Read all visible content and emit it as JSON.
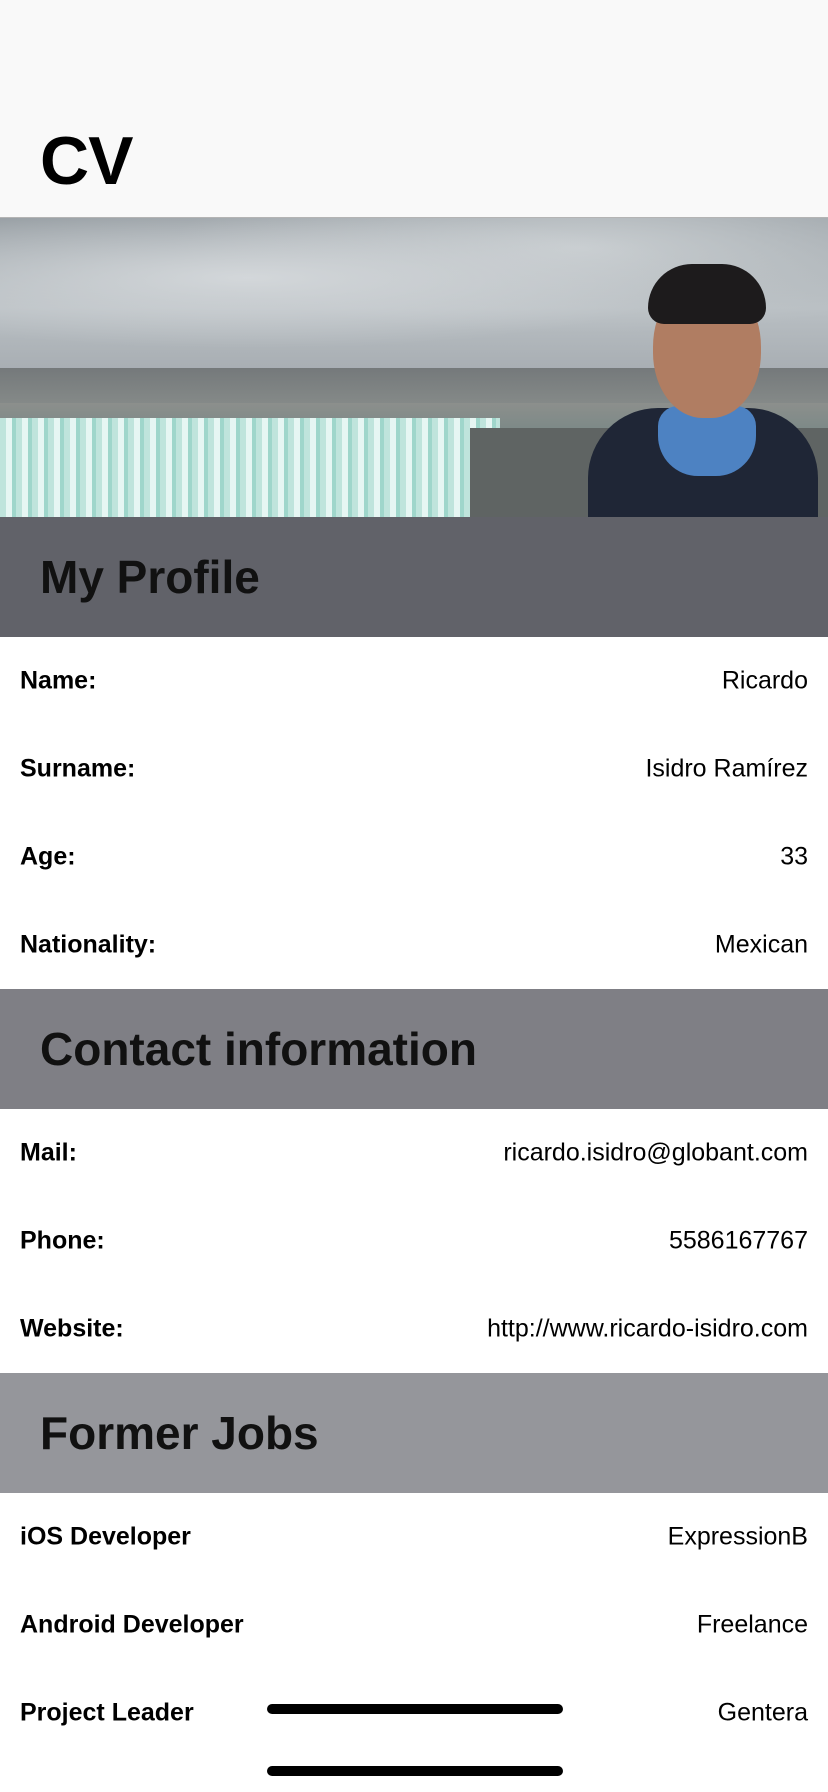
{
  "nav": {
    "title": "CV"
  },
  "hero": {
    "image": "profile-photo-waterfall"
  },
  "sections": {
    "profile": {
      "title": "My Profile",
      "rows": [
        {
          "label": "Name:",
          "value": "Ricardo"
        },
        {
          "label": "Surname:",
          "value": "Isidro Ramírez"
        },
        {
          "label": "Age:",
          "value": "33"
        },
        {
          "label": "Nationality:",
          "value": "Mexican"
        }
      ]
    },
    "contact": {
      "title": "Contact information",
      "rows": [
        {
          "label": "Mail:",
          "value": "ricardo.isidro@globant.com"
        },
        {
          "label": "Phone:",
          "value": "5586167767"
        },
        {
          "label": "Website:",
          "value": "http://www.ricardo-isidro.com"
        }
      ]
    },
    "jobs": {
      "title": "Former Jobs",
      "rows": [
        {
          "label": "iOS Developer",
          "value": "ExpressionB"
        },
        {
          "label": "Android Developer",
          "value": "Freelance"
        },
        {
          "label": "Project Leader",
          "value": "Gentera"
        }
      ]
    }
  },
  "colors": {
    "profile_header": "#616269",
    "contact_header": "#7f7f85",
    "jobs_header": "#95969b",
    "navbar_bg": "#f9f9f9"
  }
}
